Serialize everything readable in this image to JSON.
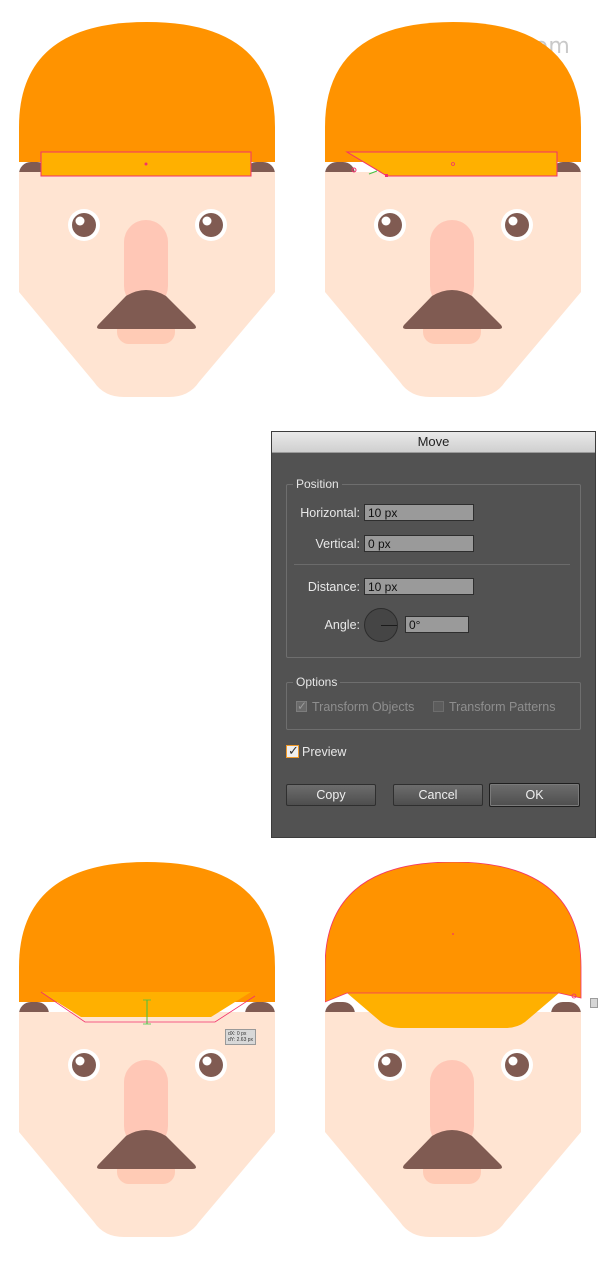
{
  "watermark": "电脑网 Yuucn.com",
  "colors": {
    "hair": "#FF9300",
    "headband": "#FFB000",
    "skin": "#FFE4D2",
    "nose": "#FFC7B6",
    "lip": "#FFCBB5",
    "brown": "#805B52",
    "selection": "#F2316C",
    "dialog_bg": "#525252",
    "accent_checkbox": "#F09A2A"
  },
  "dialog": {
    "title": "Move",
    "position": {
      "legend": "Position",
      "horizontal_label": "Horizontal:",
      "horizontal_value": "10 px",
      "vertical_label": "Vertical:",
      "vertical_value": "0 px",
      "distance_label": "Distance:",
      "distance_value": "10 px",
      "angle_label": "Angle:",
      "angle_value": "0°"
    },
    "options": {
      "legend": "Options",
      "transform_objects": "Transform Objects",
      "transform_objects_checked": true,
      "transform_patterns": "Transform Patterns",
      "transform_patterns_checked": false
    },
    "preview_label": "Preview",
    "preview_checked": true,
    "buttons": {
      "copy": "Copy",
      "cancel": "Cancel",
      "ok": "OK"
    }
  },
  "tooltip": {
    "dx": "dX: 0 px",
    "dy": "dY: 2.63 px"
  },
  "icons": [
    "angle-dial-icon",
    "checkmark-icon",
    "anchor-point-icon"
  ]
}
